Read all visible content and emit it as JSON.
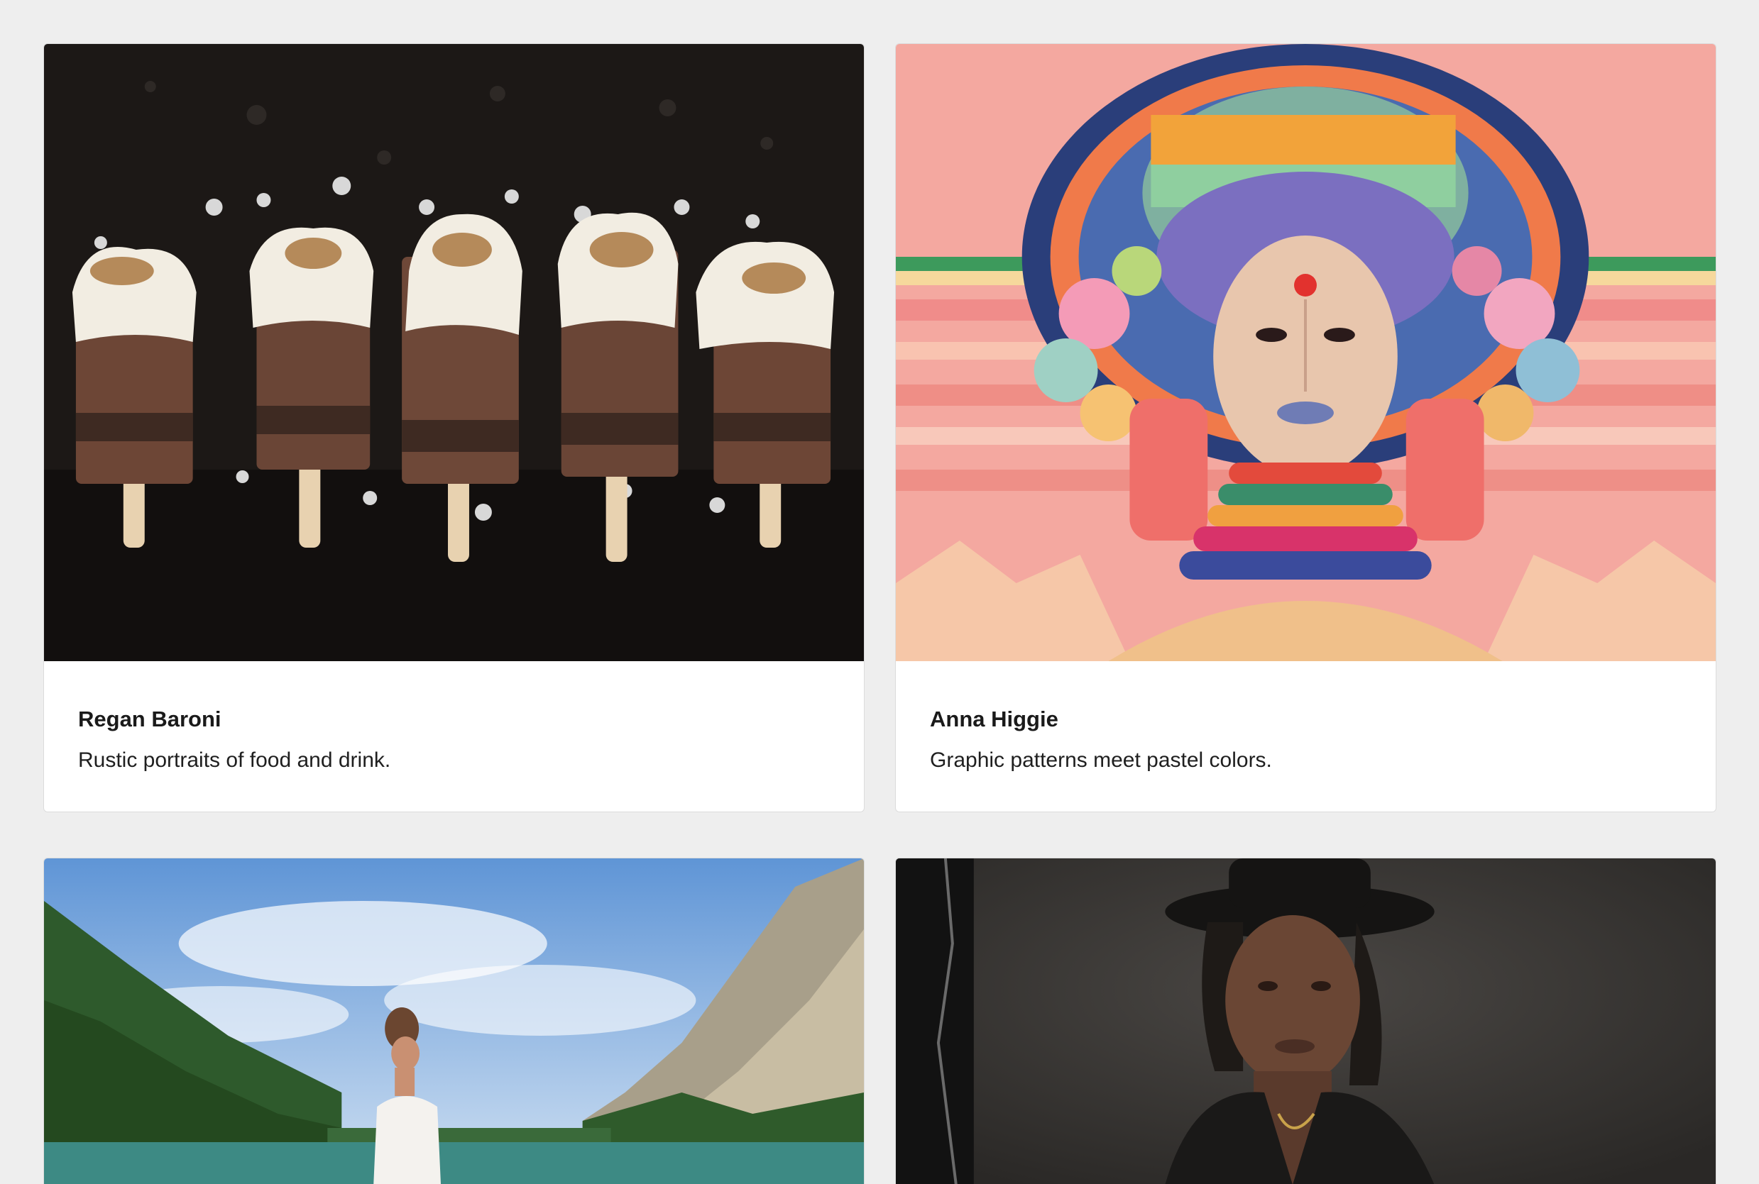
{
  "cards": [
    {
      "name": "Regan Baroni",
      "description": "Rustic portraits of food and drink.",
      "image_subject": "toasted-marshmallow chocolate popsicles on dark surface with ice"
    },
    {
      "name": "Anna Higgie",
      "description": "Graphic patterns meet pastel colors.",
      "image_subject": "colorful illustrated portrait of woman with beaded headdress"
    },
    {
      "image_subject": "woman standing by mountain lake with pine trees and cliffs"
    },
    {
      "image_subject": "portrait of person wearing black hat against dark background"
    }
  ],
  "colors": {
    "page_background": "#eeeeee",
    "card_background": "#ffffff",
    "card_border": "#dcdcdc",
    "title_text": "#1a1a1a"
  }
}
